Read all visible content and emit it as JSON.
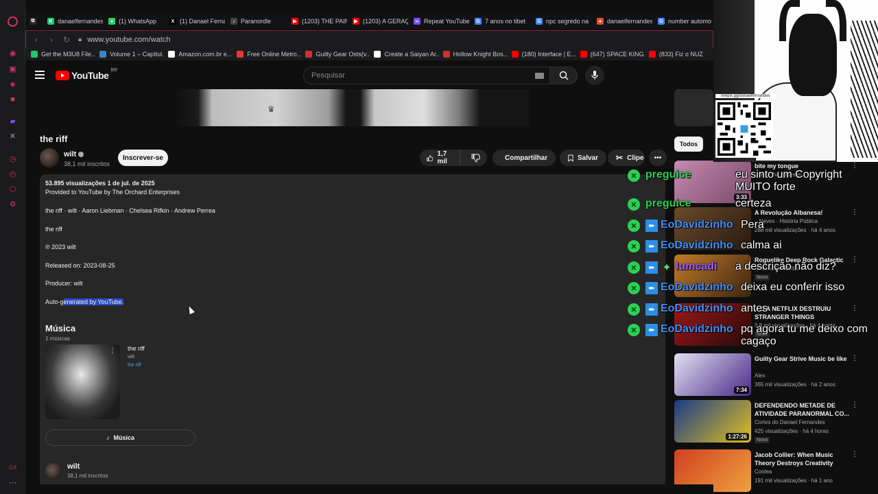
{
  "browser": {
    "tabs": [
      {
        "label": "",
        "color": "#2a2a2a",
        "glyph": "⧉"
      },
      {
        "label": "danaelfernandes",
        "color": "#1cc86b",
        "glyph": "K"
      },
      {
        "label": "(1) WhatsApp",
        "color": "#25d366",
        "glyph": "●"
      },
      {
        "label": "(1) Danael Fernandes",
        "color": "#000000",
        "glyph": "X"
      },
      {
        "label": "Paranordle",
        "color": "#444444",
        "glyph": "♪"
      },
      {
        "label": "(1203) THE PAIN",
        "color": "#ff0000",
        "glyph": "▶"
      },
      {
        "label": "(1203) A GERAÇÃO",
        "color": "#ff0000",
        "glyph": "▶"
      },
      {
        "label": "Repeat YouTube",
        "color": "#7a4cff",
        "glyph": "∞"
      },
      {
        "label": "7 anos no tibet",
        "color": "#4285f4",
        "glyph": "G"
      },
      {
        "label": "npc segredo na",
        "color": "#4285f4",
        "glyph": "G"
      },
      {
        "label": "danaelfernandes",
        "color": "#e24c2d",
        "glyph": "●"
      },
      {
        "label": "number automo",
        "color": "#4285f4",
        "glyph": "G"
      }
    ],
    "url": "www.youtube.com/watch",
    "bookmarks": [
      {
        "label": "Get the M3U8 File...",
        "color": "#1cc86b"
      },
      {
        "label": "Volume 1 – Capítul...",
        "color": "#3b82c4"
      },
      {
        "label": "Amazon.com.br e...",
        "color": "#ffffff"
      },
      {
        "label": "Free Online Metro...",
        "color": "#e53935"
      },
      {
        "label": "Guilty Gear Osts(v...",
        "color": "#d32f2f"
      },
      {
        "label": "Create a Saiyan Ar...",
        "color": "#ffffff"
      },
      {
        "label": "Hollow Knight Bos...",
        "color": "#d32f2f"
      },
      {
        "label": "(180) Interface | E...",
        "color": "#ff0000"
      },
      {
        "label": "(647) SPACE KING...",
        "color": "#ff0000"
      },
      {
        "label": "(833) Fiz o NUZ",
        "color": "#ff0000"
      }
    ]
  },
  "yt": {
    "logo": "YouTube",
    "region": "BR",
    "search_placeholder": "Pesquisar"
  },
  "video": {
    "title": "the riff",
    "channel": "wilt",
    "subs": "38,1 mil inscritos",
    "subscribe": "Inscrever-se",
    "likes": "1,7 mil",
    "share": "Compartilhar",
    "save": "Salvar",
    "clip": "Clipe"
  },
  "description": {
    "stats": "53.895 visualizações  1 de jul. de 2025",
    "provided": "Provided to YouTube by The Orchard Enterprises",
    "credits": "the riff · wilt · Aaron Liebman · Chelsea Rifkin · Andrew Perrea",
    "track": "the riff",
    "copyright": "℗ 2023 wilt",
    "released": "Released on: 2023-08-25",
    "producer": "Producer: wilt",
    "auto_prefix": "Auto-g",
    "auto_highlight": "enerated by YouTube."
  },
  "music": {
    "heading": "Música",
    "count": "1 músicas",
    "song_title": "the riff",
    "song_artist": "wilt",
    "song_album": "the riff",
    "button": "Música"
  },
  "channel_footer": {
    "name": "wilt",
    "subs": "38,1 mil inscritos"
  },
  "sidebar": {
    "chip": "Todos",
    "recs": [
      {
        "title": "bite my tongue",
        "channel": "",
        "meta": "...ões · há 6 meses",
        "duration": "3:33",
        "new": "",
        "thumb": "linear-gradient(135deg,#c48ab0,#7a4a6a)"
      },
      {
        "title": "A Revolução Albanesa!",
        "channel": "...Neves · História Pública",
        "meta": "288 mil visualizações · há 4 anos",
        "duration": "",
        "new": "",
        "thumb": "linear-gradient(135deg,#6a4a2a,#2a1a10)"
      },
      {
        "title": "Roguelike Deep Rock Galactic",
        "channel": "RUN ALEATÓRIA",
        "meta": "",
        "duration": "",
        "new": "Novo",
        "thumb": "linear-gradient(135deg,#c47a2a,#3a2410)"
      },
      {
        "title": "...O A NETFLIX DESTRUIU STRANGER THINGS",
        "channel": "",
        "meta": "3,8 mil visualizações · há 4 horas",
        "duration": "",
        "new": "Novo",
        "thumb": "linear-gradient(135deg,#9a1a1a,#2a0808)"
      },
      {
        "title": "Guilty Gear Strive Music be like",
        "channel": "Alex",
        "meta": "365 mil visualizações · há 2 anos",
        "duration": "7:34",
        "new": "",
        "thumb": "linear-gradient(135deg,#e0e0f0,#4a2a8a)"
      },
      {
        "title": "DEFENDENDO METADE DE ATIVIDADE PARANORMAL CO...",
        "channel": "Cortes do Danael Fernandes",
        "meta": "425 visualizações · há 4 horas",
        "duration": "1:27:26",
        "new": "Novo",
        "thumb": "linear-gradient(135deg,#1a3a8a,#e0c020)"
      },
      {
        "title": "Jacob Collier: When Music Theory Destroys Creativity",
        "channel": "Coolea",
        "meta": "191 mil visualizações · há 1 ano",
        "duration": "",
        "new": "",
        "thumb": "linear-gradient(135deg,#d04020,#f0a040)"
      }
    ]
  },
  "overlay": {
    "qr_label": "livepix.gg/danaelfernandes",
    "chat": [
      {
        "user": "preguice",
        "message": "eu sinto um Copyright MUITO forte",
        "badges": [
          "green"
        ],
        "color": "green"
      },
      {
        "user": "preguice",
        "message": "certeza",
        "badges": [
          "green"
        ],
        "color": "green"
      },
      {
        "user": "EoDavidzinho",
        "message": "Pera",
        "badges": [
          "green",
          "blue"
        ],
        "color": "blue"
      },
      {
        "user": "EoDavidzinho",
        "message": "calma ai",
        "badges": [
          "green",
          "blue"
        ],
        "color": "blue"
      },
      {
        "user": "lumcadi",
        "message": "a descrição não diz?",
        "badges": [
          "green",
          "blue",
          "star"
        ],
        "color": "purple"
      },
      {
        "user": "EoDavidzinho",
        "message": "deixa eu conferir isso",
        "badges": [
          "green",
          "blue"
        ],
        "color": "blue"
      },
      {
        "user": "EoDavidzinho",
        "message": "antes",
        "badges": [
          "green",
          "blue"
        ],
        "color": "blue"
      },
      {
        "user": "EoDavidzinho",
        "message": "pq agora tu me deixo com cagaço",
        "badges": [
          "green",
          "blue"
        ],
        "color": "blue"
      }
    ]
  }
}
